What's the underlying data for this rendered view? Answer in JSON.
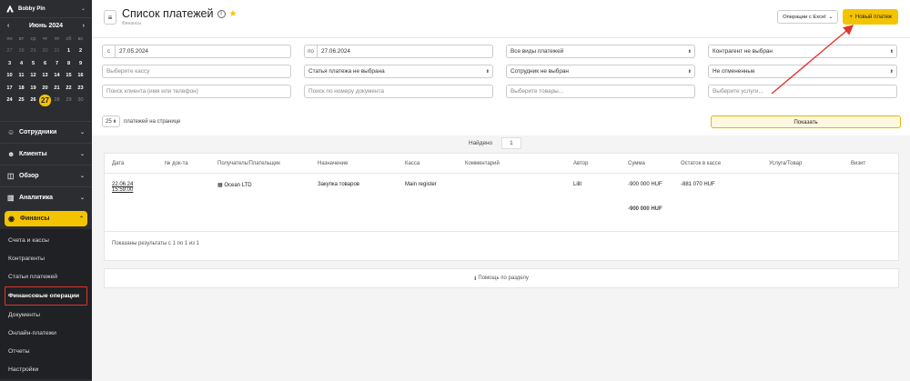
{
  "user": {
    "name": "Bobby Pin"
  },
  "calendar": {
    "month_label": "Июнь 2024",
    "weekdays": [
      "пн",
      "вт",
      "ср",
      "чт",
      "пт",
      "сб",
      "вс"
    ],
    "rows": [
      [
        "27",
        "28",
        "29",
        "30",
        "31",
        "1",
        "2"
      ],
      [
        "3",
        "4",
        "5",
        "6",
        "7",
        "8",
        "9"
      ],
      [
        "10",
        "11",
        "12",
        "13",
        "14",
        "15",
        "16"
      ],
      [
        "17",
        "18",
        "19",
        "20",
        "21",
        "22",
        "23"
      ],
      [
        "24",
        "25",
        "26",
        "27",
        "28",
        "29",
        "30"
      ]
    ],
    "today": "27"
  },
  "menu": [
    {
      "label": "Сотрудники",
      "icon": "users-icon"
    },
    {
      "label": "Клиенты",
      "icon": "clients-icon"
    },
    {
      "label": "Обзор",
      "icon": "overview-icon"
    },
    {
      "label": "Аналитика",
      "icon": "analytics-icon"
    }
  ],
  "finance_menu": {
    "label": "Финансы",
    "items": [
      "Счета и кассы",
      "Контрагенты",
      "Статьи платежей",
      "Финансовые операции",
      "Документы",
      "Онлайн-платежи",
      "Отчеты",
      "Настройки"
    ],
    "current": "Финансовые операции"
  },
  "header": {
    "title": "Список платежей",
    "breadcrumb": "Финансы",
    "excel_label": "Операции с Excel",
    "new_label": "Новый платеж"
  },
  "filters": {
    "date_from_prefix": "с",
    "date_from": "27.05.2024",
    "date_to_prefix": "по",
    "date_to": "27.06.2024",
    "payment_type": "Все виды платежей",
    "counterparty": "Контрагент не выбран",
    "cashbox_placeholder": "Выберите кассу",
    "payment_item": "Статья платежа не выбрана",
    "employee": "Сотрудник не выбран",
    "status": "Не отмененные",
    "client_placeholder": "Поиск клиента (имя или телефон)",
    "doc_placeholder": "Поиск по номеру документа",
    "goods_placeholder": "Выберите товары...",
    "services_placeholder": "Выберите услуги..."
  },
  "per_page": {
    "value": "25",
    "label": "платежей на странице"
  },
  "show_label": "Показать",
  "found": {
    "label": "Найдено",
    "count": "1"
  },
  "table": {
    "columns": [
      "Дата",
      "№ док-та",
      "Получатель/Плательщик",
      "Назначение",
      "Касса",
      "Комментарий",
      "Автор",
      "Сумма",
      "Остаток в кассе",
      "Услуга/Товар",
      "Визит"
    ],
    "rows": [
      {
        "date": "22.06.24",
        "time": "15:59:00",
        "doc": "",
        "recipient": "Ocean LTD",
        "purpose": "Закупка товаров",
        "cashbox": "Main register",
        "comment": "",
        "author": "Lilit",
        "amount": "-900 000 HUF",
        "balance": "-881 070 HUF",
        "service": "",
        "visit": ""
      }
    ],
    "total": "-900 000 HUF",
    "results_text": "Показаны результаты с 1 по 1 из 1"
  },
  "help_label": "Помощь по разделу",
  "colors": {
    "accent": "#f5c400",
    "sidebar": "#2b2d30",
    "arrow": "#e0352b"
  }
}
